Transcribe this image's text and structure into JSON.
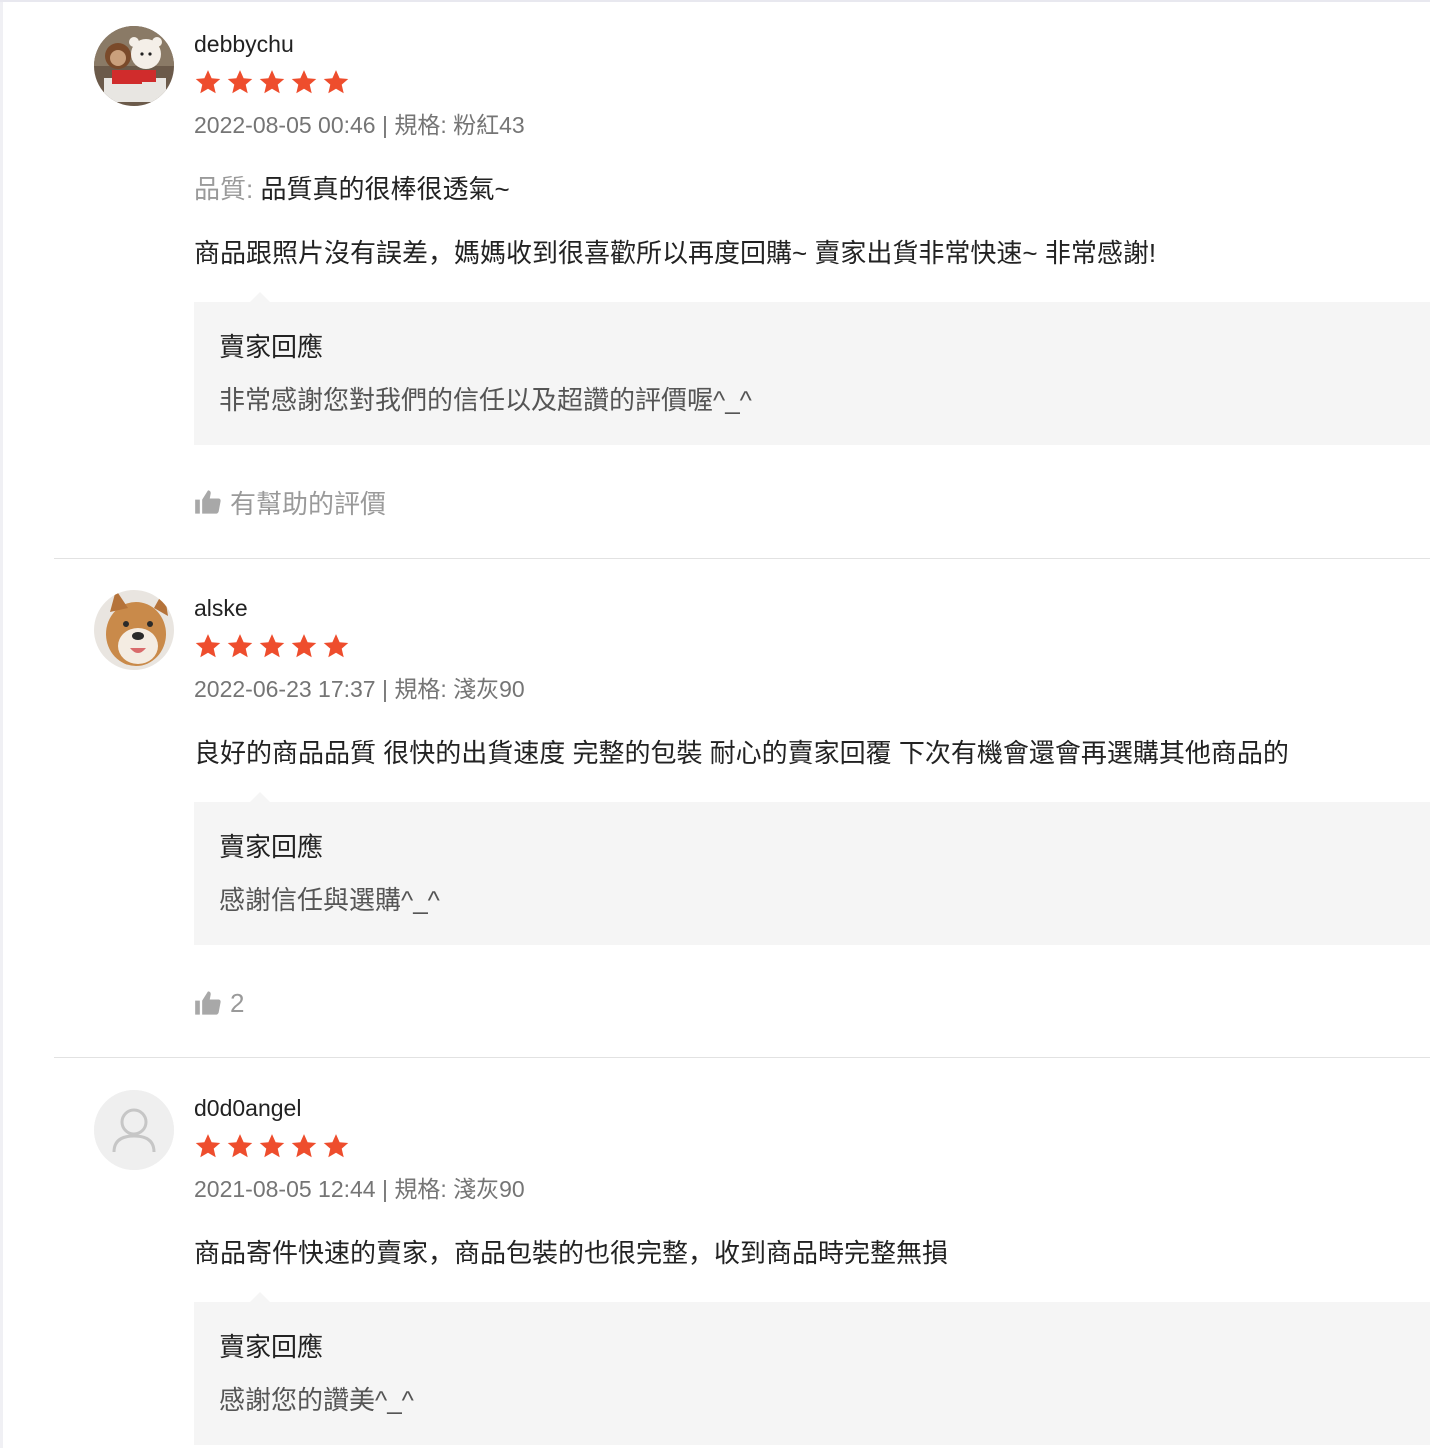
{
  "reviews": [
    {
      "username": "debbychu",
      "rating": 5,
      "meta": "2022-08-05 00:46 | 規格: 粉紅43",
      "attr_label": "品質:",
      "attr_value": "品質真的很棒很透氣~",
      "content": "商品跟照片沒有誤差，媽媽收到很喜歡所以再度回購~ 賣家出貨非常快速~ 非常感謝!",
      "reply_title": "賣家回應",
      "reply_text": "非常感謝您對我們的信任以及超讚的評價喔^_^",
      "helpful_label": "有幫助的評價",
      "avatar_icon": "plush-toys-avatar"
    },
    {
      "username": "alske",
      "rating": 5,
      "meta": "2022-06-23 17:37 | 規格: 淺灰90",
      "content": "良好的商品品質 很快的出貨速度 完整的包裝 耐心的賣家回覆 下次有機會還會再選購其他商品的",
      "reply_title": "賣家回應",
      "reply_text": "感謝信任與選購^_^",
      "helpful_label": "2",
      "avatar_icon": "shiba-dog-avatar"
    },
    {
      "username": "d0d0angel",
      "rating": 5,
      "meta": "2021-08-05 12:44 | 規格: 淺灰90",
      "content": "商品寄件快速的賣家，商品包裝的也很完整，收到商品時完整無損",
      "reply_title": "賣家回應",
      "reply_text": "感謝您的讚美^_^",
      "avatar_icon": "default-user-icon"
    }
  ],
  "colors": {
    "star": "#ee4d2d",
    "meta_text": "#757575",
    "reply_bg": "#f5f5f5",
    "divider": "#e2e2e2"
  }
}
